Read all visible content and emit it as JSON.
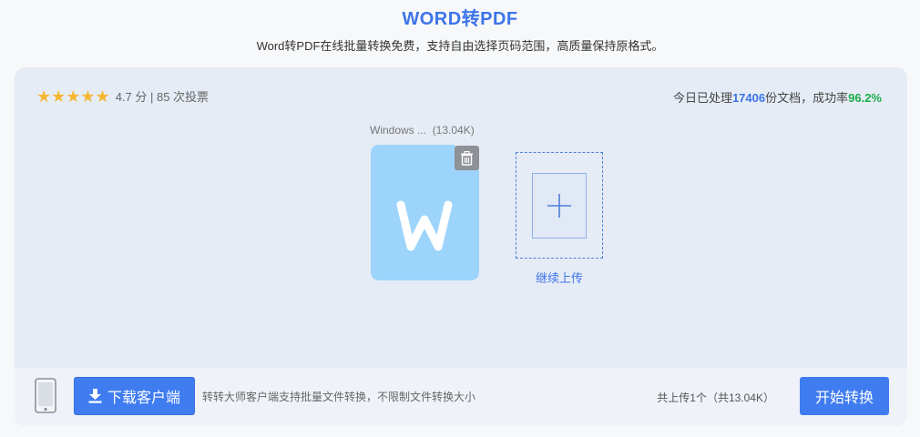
{
  "header": {
    "title": "WORD转PDF",
    "subtitle": "Word转PDF在线批量转换免费，支持自由选择页码范围，高质量保持原格式。"
  },
  "rating": {
    "stars": "★★★★★",
    "text": "4.7 分 | 85 次投票"
  },
  "stats": {
    "prefix": "今日已处理",
    "processed": "17406",
    "middle": "份文档，成功率",
    "success_rate": "96.2%"
  },
  "file": {
    "name": "Windows ...",
    "size": "(13.04K)",
    "icon": "word-file-icon"
  },
  "upload": {
    "label": "继续上传"
  },
  "footer": {
    "download_label": "下载客户端",
    "client_desc": "转转大师客户端支持批量文件转换，不限制文件转换大小",
    "upload_count": "共上传1个（共13.04K）",
    "start_label": "开始转换"
  },
  "colors": {
    "accent": "#3f7cf0",
    "success": "#1aad4b",
    "file_icon": "#9dd4fb",
    "star": "#f5b731"
  }
}
